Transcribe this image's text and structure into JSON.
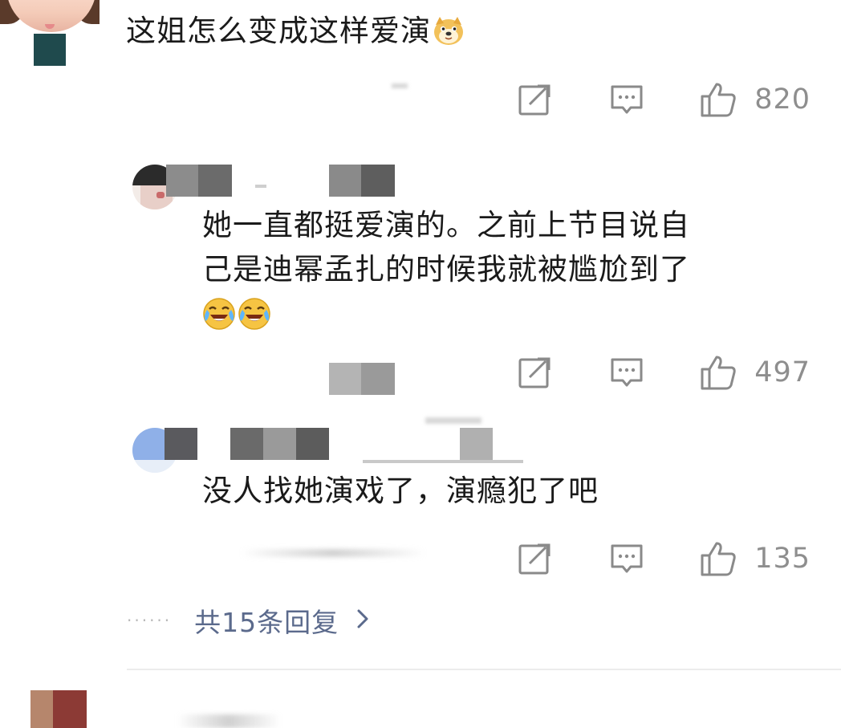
{
  "comment": {
    "text": "这姐怎么变成这样爱演",
    "emoji": "doge-emoji",
    "actions": {
      "like_count": "820"
    }
  },
  "replies": [
    {
      "text_line1": "她一直都挺爱演的。之前上节目说自",
      "text_line2": "己是迪幂孟扎的时候我就被尴尬到了",
      "emojis": [
        "laugh-cry-emoji",
        "laugh-cry-emoji"
      ],
      "like_count": "497"
    },
    {
      "text": "没人找她演戏了，演瘾犯了吧",
      "like_count": "135"
    }
  ],
  "more_replies": {
    "dots": "······",
    "label": "共15条回复"
  },
  "colors": {
    "icon_gray": "#8a8a8a",
    "link_blue": "#5b6a8c",
    "text": "#1a1a1a"
  }
}
